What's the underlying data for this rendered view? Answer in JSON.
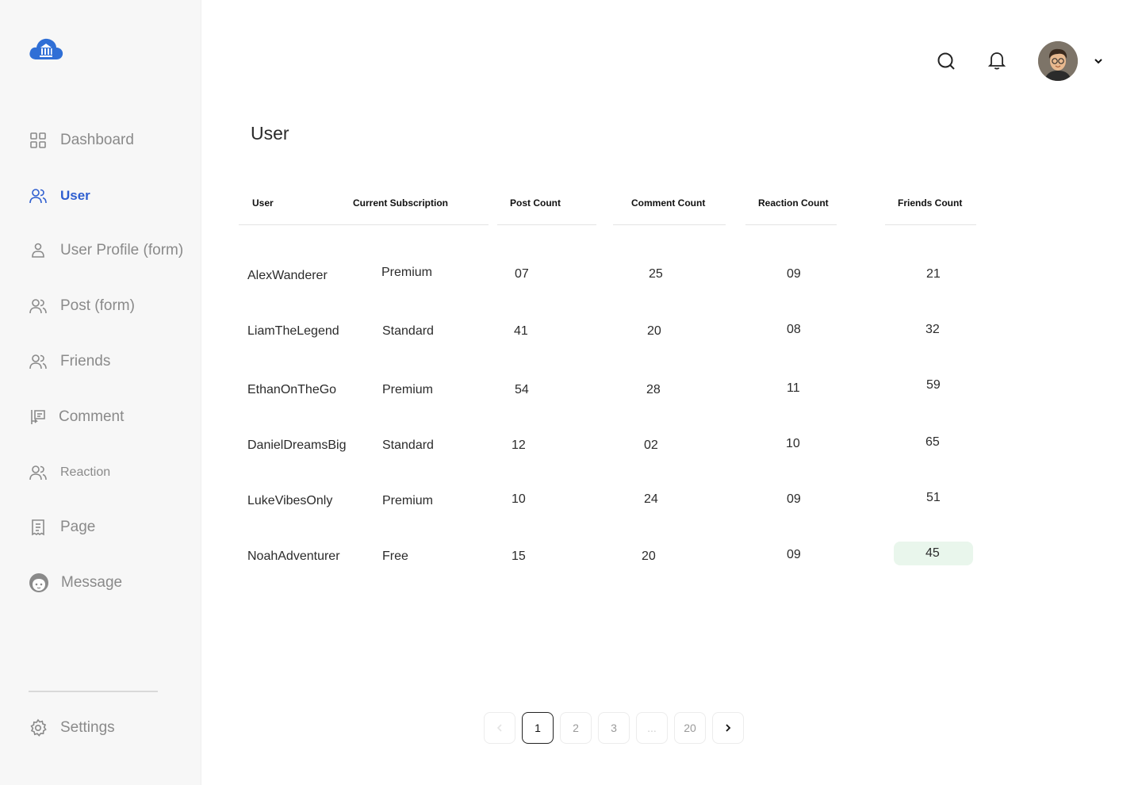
{
  "sidebar": {
    "items": [
      {
        "label": "Dashboard",
        "icon": "grid-icon"
      },
      {
        "label": "User",
        "icon": "users-icon",
        "active": true
      },
      {
        "label": "User Profile (form)",
        "icon": "user-icon"
      },
      {
        "label": "Post (form)",
        "icon": "users-icon"
      },
      {
        "label": "Friends",
        "icon": "users-icon"
      },
      {
        "label": "Comment",
        "icon": "comment-icon"
      },
      {
        "label": "Reaction",
        "icon": "users-icon"
      },
      {
        "label": "Page",
        "icon": "document-icon"
      },
      {
        "label": "Message",
        "icon": "face-icon"
      }
    ],
    "settings": {
      "label": "Settings",
      "icon": "gear-icon"
    }
  },
  "page": {
    "title": "User"
  },
  "table": {
    "headers": [
      "User",
      "Current Subscription",
      "Post Count",
      "Comment Count",
      "Reaction Count",
      "Friends Count"
    ],
    "rows": [
      [
        "AlexWanderer",
        "Premium",
        "07",
        "25",
        "09",
        "21"
      ],
      [
        "LiamTheLegend",
        "Standard",
        "41",
        "20",
        "08",
        "32"
      ],
      [
        "EthanOnTheGo",
        "Premium",
        "54",
        "28",
        "11",
        "59"
      ],
      [
        "DanielDreamsBig",
        "Standard",
        "12",
        "02",
        "10",
        "65"
      ],
      [
        "LukeVibesOnly",
        "Premium",
        "10",
        "24",
        "09",
        "51"
      ],
      [
        "NoahAdventurer",
        "Free",
        "15",
        "20",
        "09",
        "45"
      ]
    ]
  },
  "pagination": {
    "pages": [
      "1",
      "2",
      "3",
      "...",
      "20"
    ],
    "current": "1"
  },
  "colors": {
    "accent": "#2f5fd0",
    "highlight": "#e9f6ec",
    "sidebar_bg": "#f7f7f7"
  }
}
